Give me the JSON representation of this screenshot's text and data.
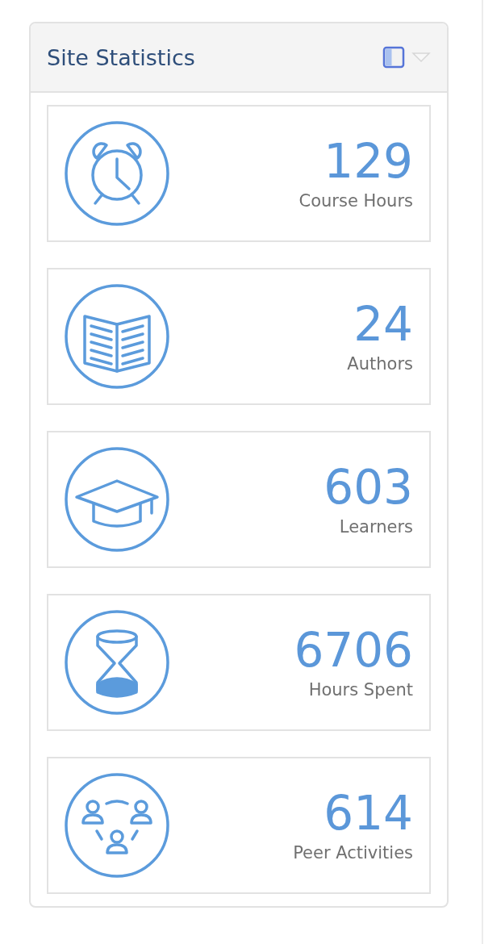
{
  "panel": {
    "title": "Site Statistics"
  },
  "stats": [
    {
      "kind": "clock",
      "value": "129",
      "label": "Course Hours"
    },
    {
      "kind": "book",
      "value": "24",
      "label": "Authors"
    },
    {
      "kind": "cap",
      "value": "603",
      "label": "Learners"
    },
    {
      "kind": "hourglass",
      "value": "6706",
      "label": "Hours Spent"
    },
    {
      "kind": "people",
      "value": "614",
      "label": "Peer Activities"
    }
  ]
}
